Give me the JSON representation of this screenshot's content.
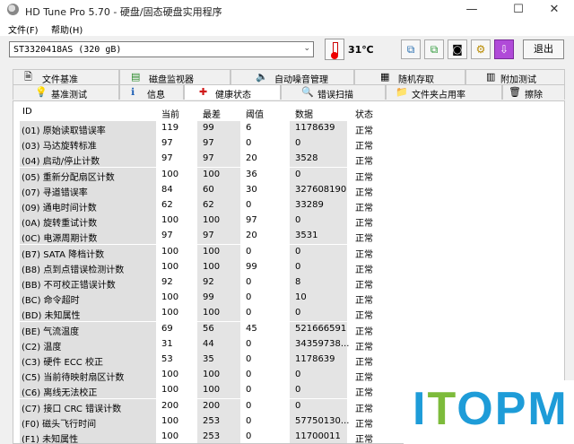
{
  "window": {
    "title": "HD Tune Pro 5.70 - 硬盘/固态硬盘实用程序",
    "minimize": "—",
    "maximize": "☐",
    "close": "✕"
  },
  "menu": {
    "file": "文件(F)",
    "help": "帮助(H)"
  },
  "toolbar": {
    "drive": "ST3320418AS (320 gB)",
    "temperature": "31℃",
    "exit_label": "退出",
    "buttons": [
      "copy-icon",
      "copy-all-icon",
      "camera-icon",
      "wrench-icon",
      "download-icon"
    ]
  },
  "tabs": {
    "row1": [
      {
        "label": "文件基准",
        "icon": "file-benchmark-icon",
        "glyph": "🗎"
      },
      {
        "label": "磁盘监视器",
        "icon": "disk-monitor-icon",
        "glyph": "▤"
      },
      {
        "label": "自动噪音管理",
        "icon": "speaker-icon",
        "glyph": "🔈"
      },
      {
        "label": "随机存取",
        "icon": "random-access-icon",
        "glyph": "▦"
      },
      {
        "label": "附加测试",
        "icon": "extra-tests-icon",
        "glyph": "▥"
      }
    ],
    "row2": [
      {
        "label": "基准测试",
        "icon": "benchmark-icon",
        "glyph": "💡"
      },
      {
        "label": "信息",
        "icon": "info-icon",
        "glyph": "ℹ"
      },
      {
        "label": "健康状态",
        "icon": "health-cross-icon",
        "glyph": "✚"
      },
      {
        "label": "错误扫描",
        "icon": "magnifier-icon",
        "glyph": "🔍"
      },
      {
        "label": "文件夹占用率",
        "icon": "folder-icon",
        "glyph": "📁"
      },
      {
        "label": "擦除",
        "icon": "trash-icon",
        "glyph": "🗑"
      }
    ],
    "active": "健康状态"
  },
  "table": {
    "headers": [
      "ID",
      "当前",
      "最差",
      "阈值",
      "数据",
      "状态"
    ],
    "rows": [
      [
        "(01) 原始读取错误率",
        "119",
        "99",
        "6",
        "1178639",
        "正常"
      ],
      [
        "(03) 马达旋转标准",
        "97",
        "97",
        "0",
        "0",
        "正常"
      ],
      [
        "(04) 启动/停止计数",
        "97",
        "97",
        "20",
        "3528",
        "正常"
      ],
      [
        "(05) 重新分配扇区计数",
        "100",
        "100",
        "36",
        "0",
        "正常"
      ],
      [
        "(07) 寻道错误率",
        "84",
        "60",
        "30",
        "327608190",
        "正常"
      ],
      [
        "(09) 通电时间计数",
        "62",
        "62",
        "0",
        "33289",
        "正常"
      ],
      [
        "(0A) 旋转重试计数",
        "100",
        "100",
        "97",
        "0",
        "正常"
      ],
      [
        "(0C) 电源周期计数",
        "97",
        "97",
        "20",
        "3531",
        "正常"
      ],
      [
        "(B7) SATA 降档计数",
        "100",
        "100",
        "0",
        "0",
        "正常"
      ],
      [
        "(B8) 点到点错误检测计数",
        "100",
        "100",
        "99",
        "0",
        "正常"
      ],
      [
        "(BB) 不可校正错误计数",
        "92",
        "92",
        "0",
        "8",
        "正常"
      ],
      [
        "(BC) 命令超时",
        "100",
        "99",
        "0",
        "10",
        "正常"
      ],
      [
        "(BD) 未知属性",
        "100",
        "100",
        "0",
        "0",
        "正常"
      ],
      [
        "(BE) 气流温度",
        "69",
        "56",
        "45",
        "521666591",
        "正常"
      ],
      [
        "(C2) 温度",
        "31",
        "44",
        "0",
        "34359738...",
        "正常"
      ],
      [
        "(C3) 硬件 ECC 校正",
        "53",
        "35",
        "0",
        "1178639",
        "正常"
      ],
      [
        "(C5) 当前待映射扇区计数",
        "100",
        "100",
        "0",
        "0",
        "正常"
      ],
      [
        "(C6) 离线无法校正",
        "100",
        "100",
        "0",
        "0",
        "正常"
      ],
      [
        "(C7) 接口 CRC 错误计数",
        "200",
        "200",
        "0",
        "0",
        "正常"
      ],
      [
        "(F0) 磁头飞行时间",
        "100",
        "253",
        "0",
        "57750130...",
        "正常"
      ],
      [
        "(F1) 未知属性",
        "100",
        "253",
        "0",
        "11700011",
        "正常"
      ]
    ]
  },
  "watermark": {
    "text": "ITOPM",
    "colors": [
      "#1e9cd8",
      "#7dbb3b",
      "#1e9cd8",
      "#1e9cd8",
      "#1e9cd8"
    ]
  }
}
